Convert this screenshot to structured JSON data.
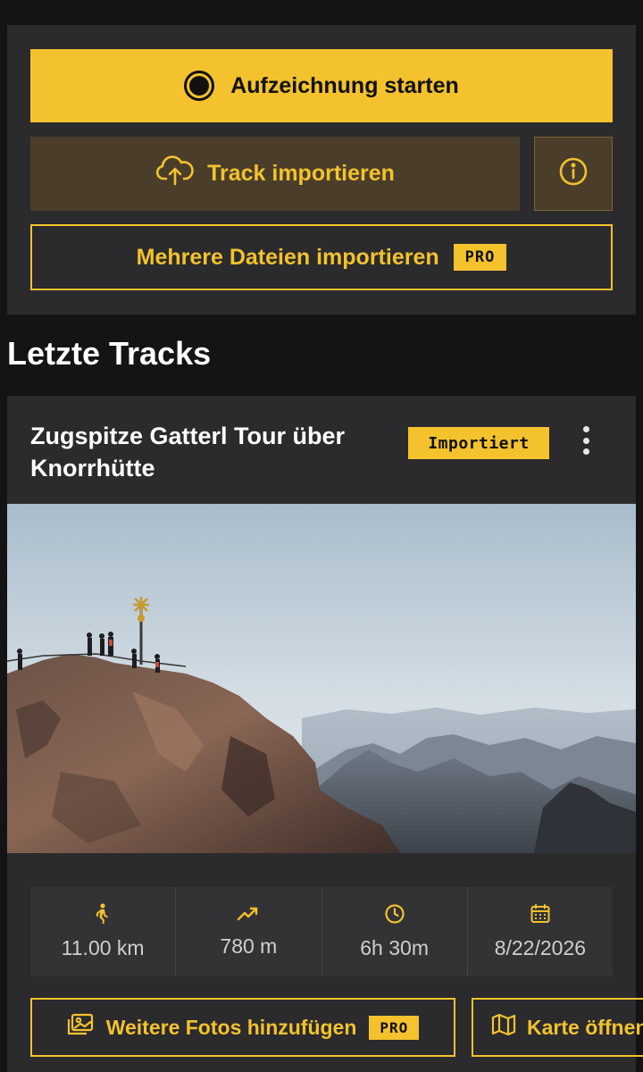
{
  "actions": {
    "record_label": "Aufzeichnung starten",
    "import_label": "Track importieren",
    "multi_import_label": "Mehrere Dateien importieren",
    "pro_badge": "PRO"
  },
  "section": {
    "title": "Letzte Tracks"
  },
  "track": {
    "title": "Zugspitze Gatterl Tour über Knorrhütte",
    "status_badge": "Importiert",
    "stats": {
      "distance": "11.00 km",
      "elevation": "780 m",
      "duration": "6h 30m",
      "date": "8/22/2026"
    },
    "add_photos_label": "Weitere Fotos hinzufügen",
    "pro_badge": "PRO",
    "open_map_label": "Karte öffnen"
  },
  "colors": {
    "accent": "#f3c22d",
    "background": "#141415",
    "card": "#2b2b2d"
  },
  "icons": [
    "record-icon",
    "cloud-upload-icon",
    "info-icon",
    "more-vertical-icon",
    "hiking-icon",
    "trending-up-icon",
    "clock-icon",
    "calendar-icon",
    "image-icon",
    "map-icon"
  ]
}
